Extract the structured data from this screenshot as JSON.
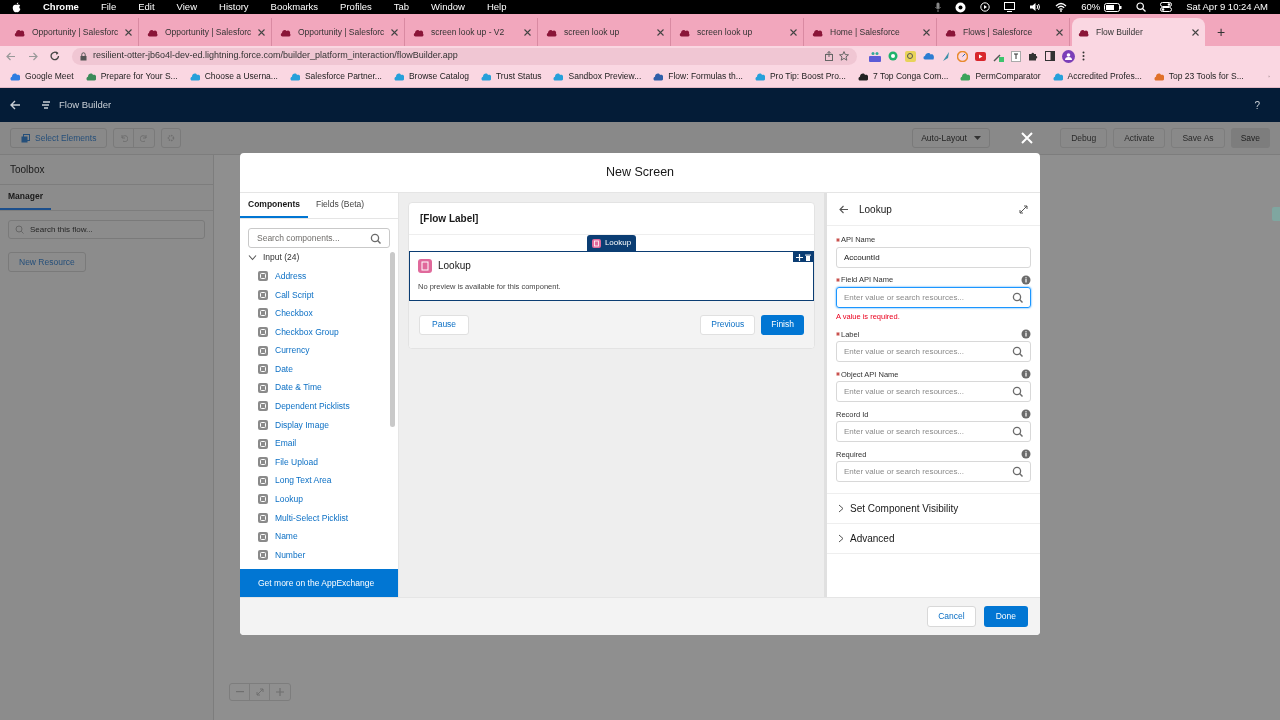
{
  "menubar": {
    "app": "Chrome",
    "menus": [
      "File",
      "Edit",
      "View",
      "History",
      "Bookmarks",
      "Profiles",
      "Tab",
      "Window",
      "Help"
    ],
    "battery": "60%",
    "clock": "Sat Apr 9  10:24 AM"
  },
  "tabs": [
    {
      "label": "Opportunity | Salesforc",
      "selected": false
    },
    {
      "label": "Opportunity | Salesforc",
      "selected": false
    },
    {
      "label": "Opportunity | Salesforc",
      "selected": false
    },
    {
      "label": "screen look up - V2",
      "selected": false
    },
    {
      "label": "screen look up",
      "selected": false
    },
    {
      "label": "screen look up",
      "selected": false
    },
    {
      "label": "Home | Salesforce",
      "selected": false
    },
    {
      "label": "Flows | Salesforce",
      "selected": false
    },
    {
      "label": "Flow Builder",
      "selected": true
    }
  ],
  "new_tab": "+",
  "address": "resilient-otter-jb6o4l-dev-ed.lightning.force.com/builder_platform_interaction/flowBuilder.app",
  "bookmarks": [
    "Google Meet",
    "Prepare for Your S...",
    "Choose a Userna...",
    "Salesforce Partner...",
    "Browse Catalog",
    "Trust Status",
    "Sandbox Preview...",
    "Flow: Formulas th...",
    "Pro Tip: Boost Pro...",
    "7 Top Conga Com...",
    "PermComparator",
    "Accredited Profes...",
    "Top 23 Tools for S..."
  ],
  "app_header": {
    "title": "Flow Builder",
    "help": "?"
  },
  "toolbar": {
    "select": "Select Elements",
    "layout": "Auto-Layout",
    "buttons": [
      "Debug",
      "Activate",
      "Save As",
      "Save"
    ]
  },
  "sidebar": {
    "title": "Toolbox",
    "tab": "Manager",
    "search_placeholder": "Search this flow...",
    "new_resource": "New Resource"
  },
  "modal": {
    "title": "New Screen",
    "palette": {
      "tabs": [
        {
          "label": "Components",
          "selected": true
        },
        {
          "label": "Fields (Beta)",
          "selected": false
        }
      ],
      "search_placeholder": "Search components...",
      "group": {
        "label": "Input (24)",
        "expanded": true,
        "children": [
          "Address",
          "Call Script",
          "Checkbox",
          "Checkbox Group",
          "Currency",
          "Date",
          "Date & Time",
          "Dependent Picklists",
          "Display Image",
          "Email",
          "File Upload",
          "Long Text Area",
          "Lookup",
          "Multi-Select Picklist",
          "Name",
          "Number"
        ]
      },
      "appexchange": "Get more on the AppExchange"
    },
    "canvas": {
      "flow_label": "[Flow Label]",
      "tag": "Lookup",
      "component": {
        "title": "Lookup",
        "note": "No preview is available for this component.",
        "selected": true
      },
      "footer": {
        "pause": "Pause",
        "previous": "Previous",
        "finish": "Finish"
      }
    },
    "properties": {
      "title": "Lookup",
      "fields": [
        {
          "label": "API Name",
          "required": true,
          "info": false,
          "value": "AccountId",
          "search": false
        },
        {
          "label": "Field API Name",
          "required": true,
          "info": true,
          "placeholder": "Enter value or search resources...",
          "search": true,
          "focused": true,
          "error": "A value is required."
        },
        {
          "label": "Label",
          "required": true,
          "info": true,
          "placeholder": "Enter value or search resources...",
          "search": true
        },
        {
          "label": "Object API Name",
          "required": true,
          "info": true,
          "placeholder": "Enter value or search resources...",
          "search": true
        },
        {
          "label": "Record Id",
          "required": false,
          "info": true,
          "placeholder": "Enter value or search resources...",
          "search": true
        },
        {
          "label": "Required",
          "required": false,
          "info": true,
          "placeholder": "Enter value or search resources...",
          "search": true
        }
      ],
      "sections": [
        {
          "label": "Set Component Visibility",
          "expanded": false
        },
        {
          "label": "Advanced",
          "expanded": false
        }
      ]
    },
    "buttons": {
      "cancel": "Cancel",
      "done": "Done"
    }
  }
}
